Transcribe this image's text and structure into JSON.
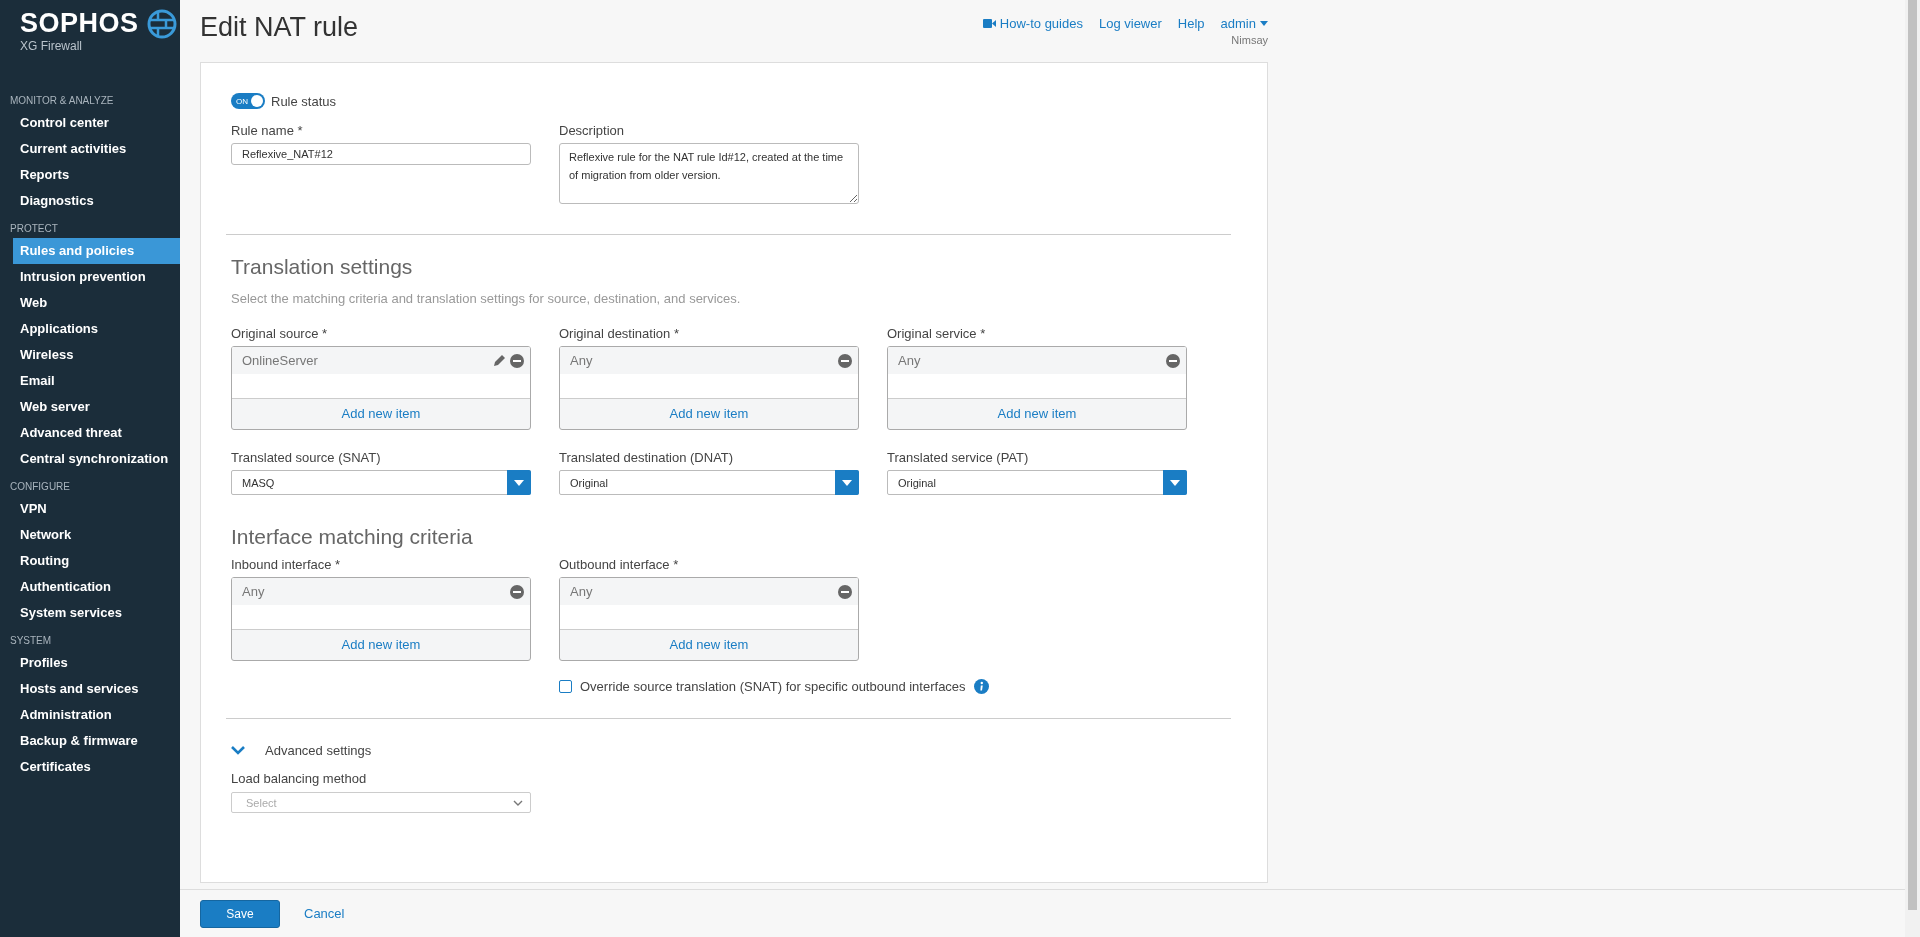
{
  "sidebar": {
    "brand": "SOPHOS",
    "product": "XG Firewall",
    "sections": [
      {
        "title": "MONITOR & ANALYZE",
        "items": [
          {
            "label": "Control center",
            "selected": false
          },
          {
            "label": "Current activities",
            "selected": false
          },
          {
            "label": "Reports",
            "selected": false
          },
          {
            "label": "Diagnostics",
            "selected": false
          }
        ]
      },
      {
        "title": "PROTECT",
        "items": [
          {
            "label": "Rules and policies",
            "selected": true
          },
          {
            "label": "Intrusion prevention",
            "selected": false
          },
          {
            "label": "Web",
            "selected": false
          },
          {
            "label": "Applications",
            "selected": false
          },
          {
            "label": "Wireless",
            "selected": false
          },
          {
            "label": "Email",
            "selected": false
          },
          {
            "label": "Web server",
            "selected": false
          },
          {
            "label": "Advanced threat",
            "selected": false
          },
          {
            "label": "Central synchronization",
            "selected": false
          }
        ]
      },
      {
        "title": "CONFIGURE",
        "items": [
          {
            "label": "VPN",
            "selected": false
          },
          {
            "label": "Network",
            "selected": false
          },
          {
            "label": "Routing",
            "selected": false
          },
          {
            "label": "Authentication",
            "selected": false
          },
          {
            "label": "System services",
            "selected": false
          }
        ]
      },
      {
        "title": "SYSTEM",
        "items": [
          {
            "label": "Profiles",
            "selected": false
          },
          {
            "label": "Hosts and services",
            "selected": false
          },
          {
            "label": "Administration",
            "selected": false
          },
          {
            "label": "Backup & firmware",
            "selected": false
          },
          {
            "label": "Certificates",
            "selected": false
          }
        ]
      }
    ]
  },
  "header": {
    "title": "Edit NAT rule",
    "links": [
      {
        "label": "How-to guides",
        "kind": "video"
      },
      {
        "label": "Log viewer",
        "kind": "plain"
      },
      {
        "label": "Help",
        "kind": "plain"
      },
      {
        "label": "admin",
        "kind": "dropdown"
      }
    ],
    "user_subtitle": "Nimsay"
  },
  "rule_status": {
    "toggle_text": "ON",
    "on": true,
    "label": "Rule status"
  },
  "rule_name": {
    "label": "Rule name *",
    "value": "Reflexive_NAT#12"
  },
  "description": {
    "label": "Description",
    "value": "Reflexive rule for the NAT rule Id#12, created at the time of migration from older version."
  },
  "translation": {
    "heading": "Translation settings",
    "subtitle": "Select the matching criteria and translation settings for source, destination, and services.",
    "lists": [
      {
        "label": "Original source *",
        "items": [
          {
            "text": "OnlineServer",
            "editable": true
          }
        ],
        "add_label": "Add new item"
      },
      {
        "label": "Original destination *",
        "items": [
          {
            "text": "Any",
            "editable": false
          }
        ],
        "add_label": "Add new item"
      },
      {
        "label": "Original service *",
        "items": [
          {
            "text": "Any",
            "editable": false
          }
        ],
        "add_label": "Add new item"
      }
    ],
    "selects": [
      {
        "label": "Translated source (SNAT)",
        "value": "MASQ"
      },
      {
        "label": "Translated destination (DNAT)",
        "value": "Original"
      },
      {
        "label": "Translated service (PAT)",
        "value": "Original"
      }
    ]
  },
  "interface": {
    "heading": "Interface matching criteria",
    "lists": [
      {
        "label": "Inbound interface *",
        "items": [
          {
            "text": "Any",
            "editable": false
          }
        ],
        "add_label": "Add new item"
      },
      {
        "label": "Outbound interface *",
        "items": [
          {
            "text": "Any",
            "editable": false
          }
        ],
        "add_label": "Add new item"
      }
    ],
    "override": {
      "label": "Override source translation (SNAT) for specific outbound interfaces",
      "checked": false
    }
  },
  "advanced": {
    "label": "Advanced settings",
    "expanded": true,
    "load_balancing": {
      "label": "Load balancing method",
      "placeholder": "Select"
    }
  },
  "footer": {
    "save": "Save",
    "cancel": "Cancel"
  }
}
